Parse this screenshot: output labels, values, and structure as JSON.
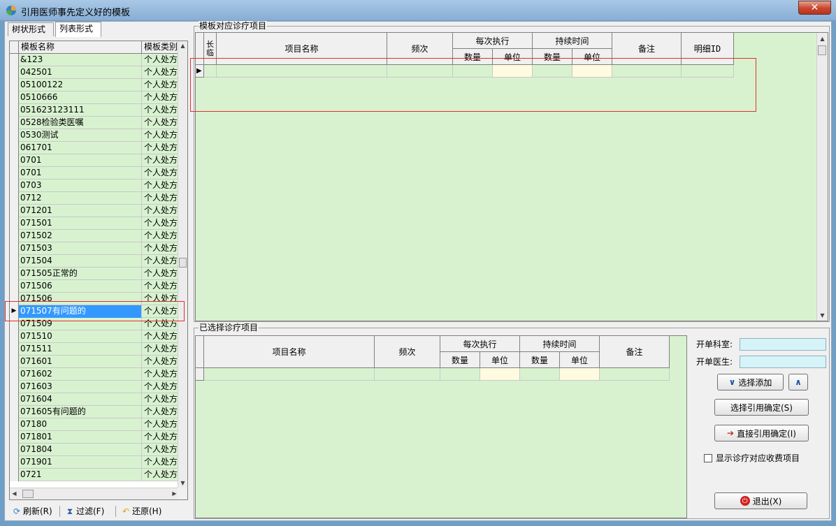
{
  "window": {
    "title": "引用医师事先定义好的模板",
    "close_glyph": "✕"
  },
  "left": {
    "tabs": [
      "树状形式",
      "列表形式"
    ],
    "columns": [
      "模板名称",
      "模板类别"
    ],
    "rows": [
      {
        "name": "&123",
        "type": "个人处方"
      },
      {
        "name": "042501",
        "type": "个人处方"
      },
      {
        "name": "05100122",
        "type": "个人处方"
      },
      {
        "name": "0510666",
        "type": "个人处方"
      },
      {
        "name": "051623123111",
        "type": "个人处方"
      },
      {
        "name": "0528检验类医嘱",
        "type": "个人处方"
      },
      {
        "name": "0530测试",
        "type": "个人处方"
      },
      {
        "name": "061701",
        "type": "个人处方"
      },
      {
        "name": "0701",
        "type": "个人处方"
      },
      {
        "name": "0701",
        "type": "个人处方"
      },
      {
        "name": "0703",
        "type": "个人处方"
      },
      {
        "name": "0712",
        "type": "个人处方"
      },
      {
        "name": "071201",
        "type": "个人处方"
      },
      {
        "name": "071501",
        "type": "个人处方"
      },
      {
        "name": "071502",
        "type": "个人处方"
      },
      {
        "name": "071503",
        "type": "个人处方"
      },
      {
        "name": "071504",
        "type": "个人处方"
      },
      {
        "name": "071505正常的",
        "type": "个人处方"
      },
      {
        "name": "071506",
        "type": "个人处方"
      },
      {
        "name": "071506",
        "type": "个人处方"
      },
      {
        "name": "071507有问题的",
        "type": "个人处方"
      },
      {
        "name": "071509",
        "type": "个人处方"
      },
      {
        "name": "071510",
        "type": "个人处方"
      },
      {
        "name": "071511",
        "type": "个人处方"
      },
      {
        "name": "071601",
        "type": "个人处方"
      },
      {
        "name": "071602",
        "type": "个人处方"
      },
      {
        "name": "071603",
        "type": "个人处方"
      },
      {
        "name": "071604",
        "type": "个人处方"
      },
      {
        "name": "071605有问题的",
        "type": "个人处方"
      },
      {
        "name": "07180",
        "type": "个人处方"
      },
      {
        "name": "071801",
        "type": "个人处方"
      },
      {
        "name": "071804",
        "type": "个人处方"
      },
      {
        "name": "071901",
        "type": "个人处方"
      },
      {
        "name": "0721",
        "type": "个人处方"
      }
    ],
    "selected_index": 20,
    "tools": {
      "refresh": "刷新(R)",
      "filter": "过滤(F)",
      "restore": "还原(H)"
    }
  },
  "top_group": {
    "title": "模板对应诊疗项目",
    "headers": {
      "long_short": "长临",
      "item_name": "项目名称",
      "frequency": "频次",
      "per_exec": "每次执行",
      "qty": "数量",
      "unit": "单位",
      "duration": "持续时间",
      "qty2": "数量",
      "unit2": "单位",
      "note": "备注",
      "detail_id": "明细ID"
    },
    "row_indicator": "▶"
  },
  "bottom_group": {
    "title": "已选择诊疗项目",
    "headers": {
      "item_name": "项目名称",
      "frequency": "频次",
      "per_exec": "每次执行",
      "qty": "数量",
      "unit": "单位",
      "duration": "持续时间",
      "qty2": "数量",
      "unit2": "单位",
      "note": "备注"
    }
  },
  "right_panel": {
    "dept_label": "开单科室:",
    "dept_value": "",
    "doctor_label": "开单医生:",
    "doctor_value": "",
    "select_add": "选择添加",
    "select_confirm": "选择引用确定(S)",
    "direct_confirm": "直接引用确定(I)",
    "show_fee_items": "显示诊疗对应收费项目",
    "exit": "退出(X)"
  }
}
